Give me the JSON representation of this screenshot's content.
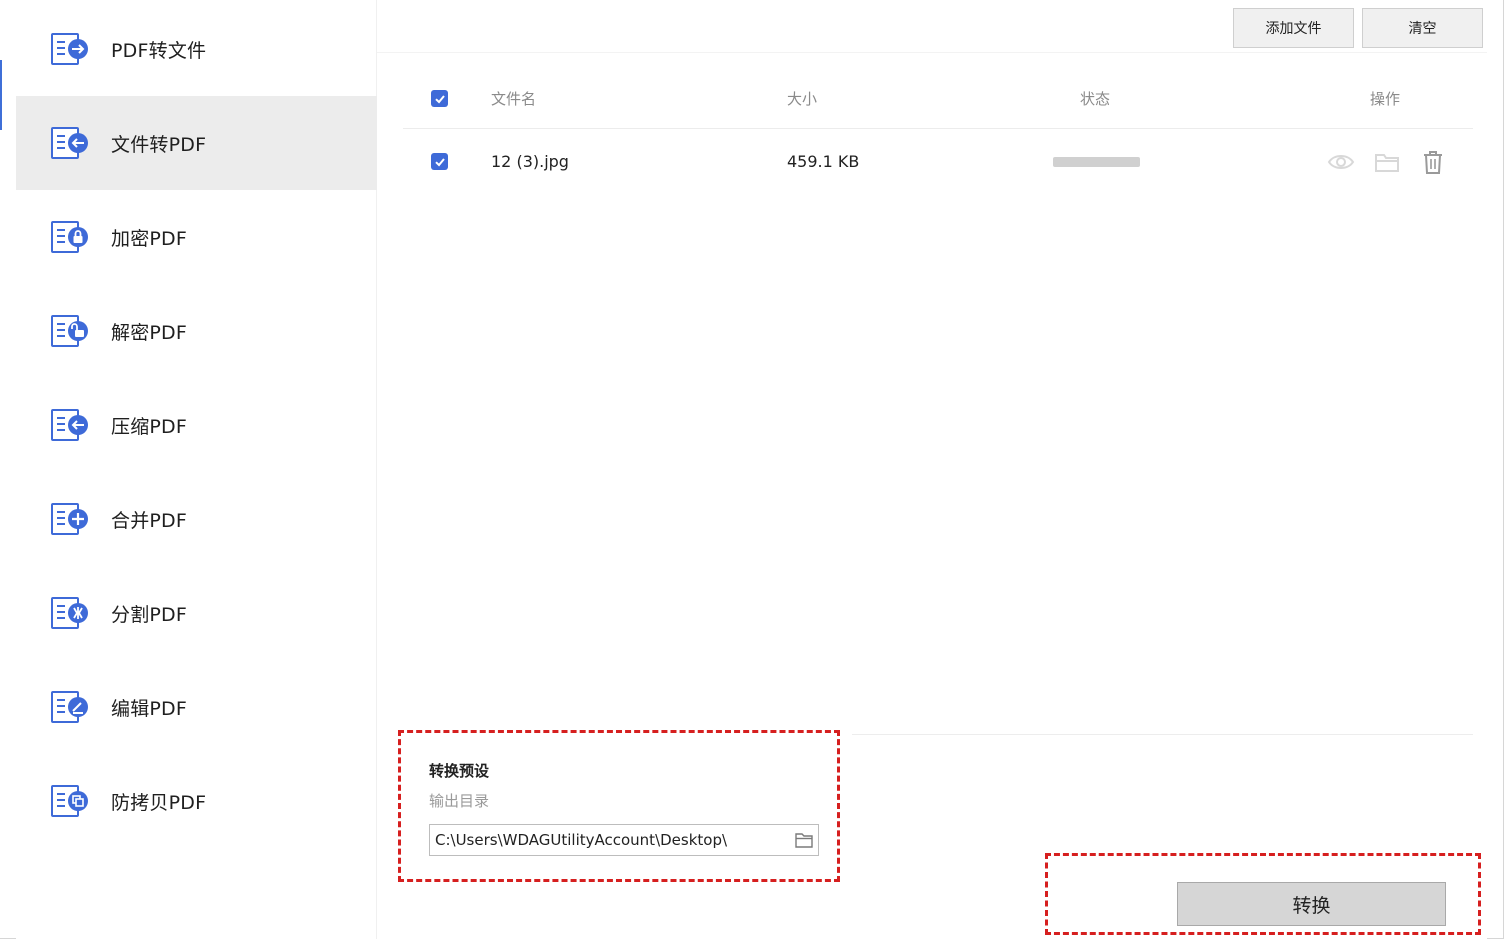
{
  "sidebar": {
    "items": [
      {
        "label": "PDF转文件",
        "icon": "arrow-right-icon",
        "active": false
      },
      {
        "label": "文件转PDF",
        "icon": "arrow-left-icon",
        "active": true
      },
      {
        "label": "加密PDF",
        "icon": "lock-icon",
        "active": false
      },
      {
        "label": "解密PDF",
        "icon": "unlock-icon",
        "active": false
      },
      {
        "label": "压缩PDF",
        "icon": "compress-icon",
        "active": false
      },
      {
        "label": "合并PDF",
        "icon": "plus-icon",
        "active": false
      },
      {
        "label": "分割PDF",
        "icon": "split-icon",
        "active": false
      },
      {
        "label": "编辑PDF",
        "icon": "edit-icon",
        "active": false
      },
      {
        "label": "防拷贝PDF",
        "icon": "copy-protect-icon",
        "active": false
      }
    ]
  },
  "toolbar": {
    "add_files_label": "添加文件",
    "clear_label": "清空"
  },
  "table": {
    "headers": {
      "filename": "文件名",
      "size": "大小",
      "status": "状态",
      "actions": "操作"
    },
    "rows": [
      {
        "filename": "12 (3).jpg",
        "size": "459.1 KB",
        "selected": true
      }
    ]
  },
  "preset": {
    "title": "转换预设",
    "output_dir_label": "输出目录",
    "output_dir_value": "C:\\Users\\WDAGUtilityAccount\\Desktop\\"
  },
  "convert_label": "转换",
  "colors": {
    "accent": "#3e6ad8",
    "highlight_dash": "#d61f1f",
    "active_bg": "#ececec"
  }
}
